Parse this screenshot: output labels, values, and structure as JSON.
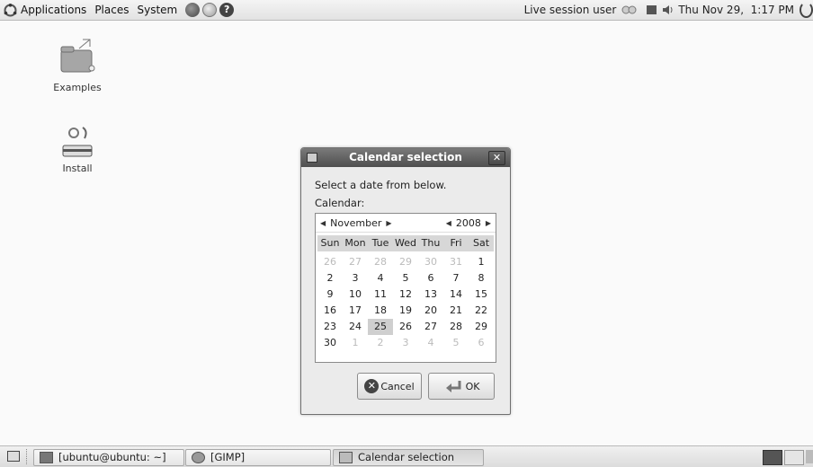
{
  "top_panel": {
    "menus": [
      "Applications",
      "Places",
      "System"
    ],
    "user": "Live session user",
    "clock": "Thu Nov 29,  1:17 PM"
  },
  "desktop": {
    "icons": [
      {
        "label": "Examples"
      },
      {
        "label": "Install"
      }
    ]
  },
  "dialog": {
    "title": "Calendar selection",
    "prompt": "Select a date from below.",
    "calendar_label": "Calendar:",
    "month": "November",
    "year": "2008",
    "day_names": [
      "Sun",
      "Mon",
      "Tue",
      "Wed",
      "Thu",
      "Fri",
      "Sat"
    ],
    "weeks": [
      [
        "26",
        "27",
        "28",
        "29",
        "30",
        "31",
        "1"
      ],
      [
        "2",
        "3",
        "4",
        "5",
        "6",
        "7",
        "8"
      ],
      [
        "9",
        "10",
        "11",
        "12",
        "13",
        "14",
        "15"
      ],
      [
        "16",
        "17",
        "18",
        "19",
        "20",
        "21",
        "22"
      ],
      [
        "23",
        "24",
        "25",
        "26",
        "27",
        "28",
        "29"
      ],
      [
        "30",
        "1",
        "2",
        "3",
        "4",
        "5",
        "6"
      ]
    ],
    "selected_day": "25",
    "cancel_label": "Cancel",
    "ok_label": "OK"
  },
  "taskbar": {
    "tasks": [
      "[ubuntu@ubuntu: ~]",
      "[GIMP]",
      "Calendar selection"
    ]
  }
}
